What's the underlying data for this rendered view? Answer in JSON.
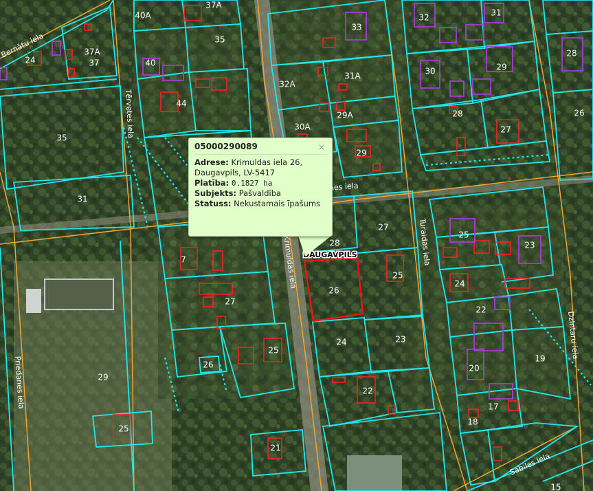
{
  "popup": {
    "title": "05000290089",
    "close": "×",
    "rows": [
      {
        "label": "Adrese:",
        "value": "Krimuldas iela 26, Daugavpils, LV-5417"
      },
      {
        "label": "Platība:",
        "value": "0.1827 ha"
      },
      {
        "label": "Subjekts:",
        "value": "Pašvaldība"
      },
      {
        "label": "Statuss:",
        "value": "Nekustamais īpašums"
      }
    ]
  },
  "city_label": "DAUGAVPILS",
  "streets": {
    "bernatu": "Bernātu iela",
    "tervetes": "Tērvetes iela",
    "priedanes": "Priedanes iela",
    "krimuldas": "Krimuldas iela",
    "turaidas": "Turaidas iela",
    "dzintaru": "Dzintaru iela",
    "sabiles": "Sabiles iela",
    "priedanes2": "Priedanes iela"
  },
  "parcels": {
    "p40a": "40A",
    "p37a_top": "37A",
    "p35a": "35",
    "p37a": "37A",
    "p37": "37",
    "p24l": "24",
    "p40": "40",
    "p44": "44",
    "p35": "35",
    "p31l": "31",
    "p33": "33",
    "p32a": "32A",
    "p31a": "31A",
    "p30a": "30A",
    "p29a": "29A",
    "p29": "29",
    "p32": "32",
    "p31": "31",
    "p28r": "28",
    "p30": "30",
    "p29r": "29",
    "p28": "28",
    "p27r": "27",
    "p26r": "26",
    "p7": "7",
    "p27m": "27",
    "p26m": "26",
    "p28m": "28",
    "p27": "27",
    "p25m": "25",
    "p26b": "26",
    "p25b": "25",
    "p29b": "29",
    "p25bl": "25",
    "p24": "24",
    "p23": "23",
    "p22": "22",
    "p21": "21",
    "p25r": "25",
    "p23r": "23",
    "p24r": "24",
    "p22r": "22",
    "p20": "20",
    "p19": "19",
    "p17": "17",
    "p18": "18",
    "p15": "15"
  },
  "colors": {
    "parcel_line": "#22e6ee",
    "road_line": "#f2a532",
    "building_red": "#ff2020",
    "building_purple": "#a040d0",
    "selected": "#ff1010",
    "popup_bg": "#e1ffc8"
  }
}
